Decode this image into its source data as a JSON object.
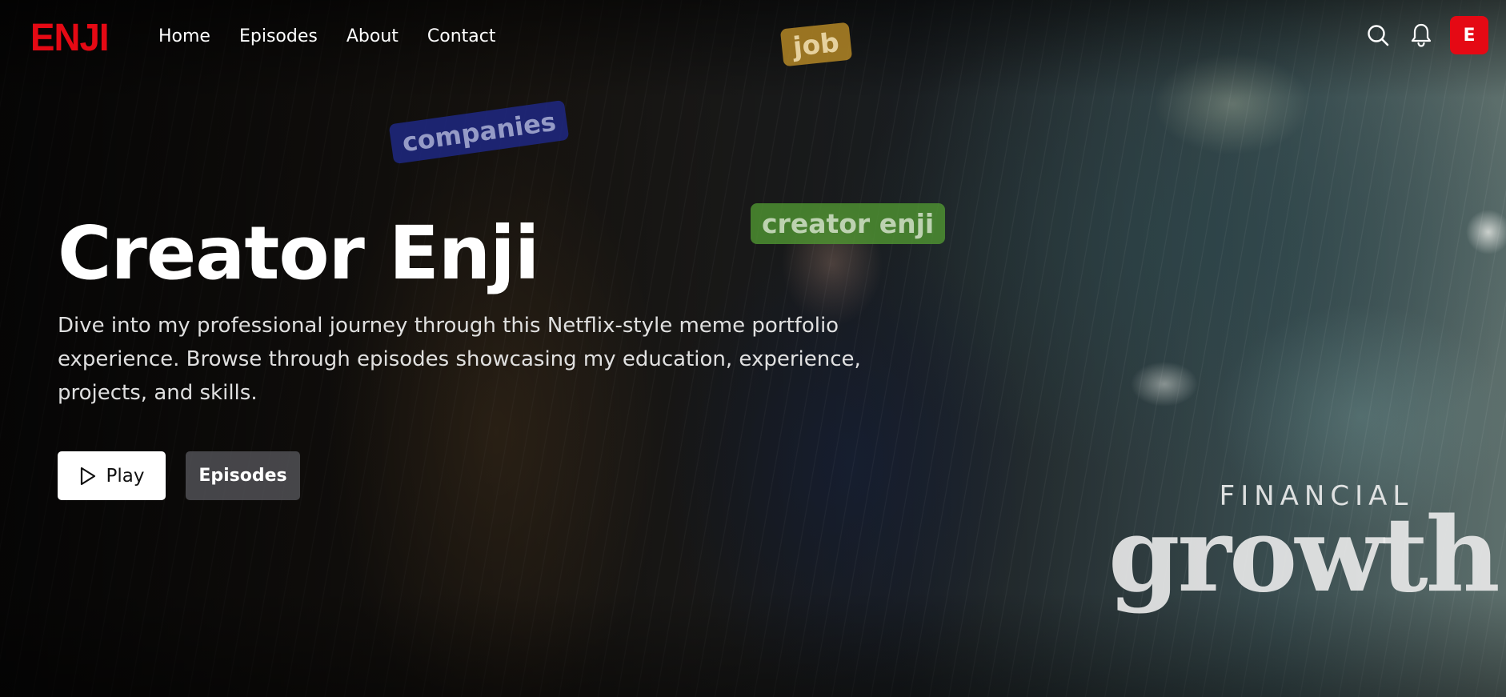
{
  "nav": {
    "logo": "ENJI",
    "links": [
      "Home",
      "Episodes",
      "About",
      "Contact"
    ],
    "avatar_initial": "E",
    "icons": [
      "search-icon",
      "bell-icon"
    ]
  },
  "hero": {
    "title": "Creator Enji",
    "description": "Dive into my professional journey through this Netflix-style meme portfolio experience. Browse through episodes showcasing my education, experience, projects, and skills.",
    "play_label": "Play",
    "episodes_label": "Episodes",
    "stickers": {
      "job": "job",
      "companies": "companies",
      "creator": "creator enji"
    },
    "brand": {
      "line1": "FINANCIAL",
      "line2": "growth"
    }
  },
  "colors": {
    "accent": "#e50914",
    "play_bg": "#ffffff",
    "episodes_bg": "#5a5a5f"
  }
}
